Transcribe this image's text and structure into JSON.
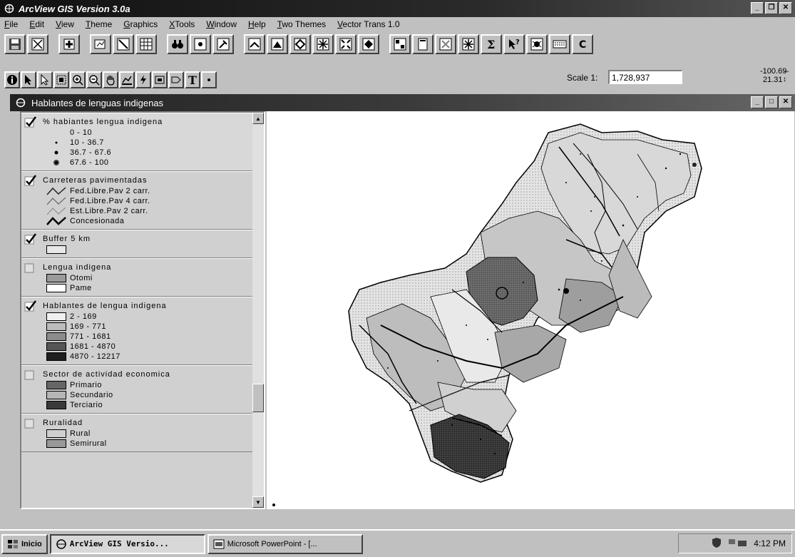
{
  "app": {
    "title": "ArcView GIS Version 3.0a"
  },
  "menu": [
    "File",
    "Edit",
    "View",
    "Theme",
    "Graphics",
    "XTools",
    "Window",
    "Help",
    "Two Themes",
    "Vector Trans 1.0"
  ],
  "toolbar": {
    "scale_label": "Scale 1:",
    "scale_value": "1,728,937",
    "coord_x": "-100.69",
    "coord_y": "21.31"
  },
  "document": {
    "title": "Hablantes de lenguas indigenas"
  },
  "legend": {
    "themes": [
      {
        "name": "% habiantes lengua indigena",
        "checked": true,
        "items": [
          "0 - 10",
          "10 - 36.7",
          "36.7 - 67.6",
          "67.6 - 100"
        ]
      },
      {
        "name": "Carreteras pavimentadas",
        "checked": true,
        "items": [
          "Fed.Libre.Pav 2 carr.",
          "Fed.Libre.Pav 4 carr.",
          "Est.Libre.Pav 2 carr.",
          "Concesionada"
        ]
      },
      {
        "name": "Buffer 5 km",
        "checked": true,
        "items": []
      },
      {
        "name": "Lengua indigena",
        "checked": false,
        "items": [
          "Otomi",
          "Pame"
        ]
      },
      {
        "name": "Hablantes de lengua indigena",
        "checked": true,
        "items": [
          "2 - 169",
          "169 - 771",
          "771 - 1681",
          "1681 - 4870",
          "4870 - 12217"
        ]
      },
      {
        "name": "Sector de actividad economica",
        "checked": false,
        "items": [
          "Primario",
          "Secundario",
          "Terciario"
        ]
      },
      {
        "name": "Ruralidad",
        "checked": false,
        "items": [
          "Rural",
          "Semirural"
        ]
      }
    ]
  },
  "taskbar": {
    "start_label": "Inicio",
    "tasks": [
      "ArcView GIS Versio...",
      "Microsoft PowerPoint - [..."
    ],
    "clock": "4:12 PM"
  }
}
